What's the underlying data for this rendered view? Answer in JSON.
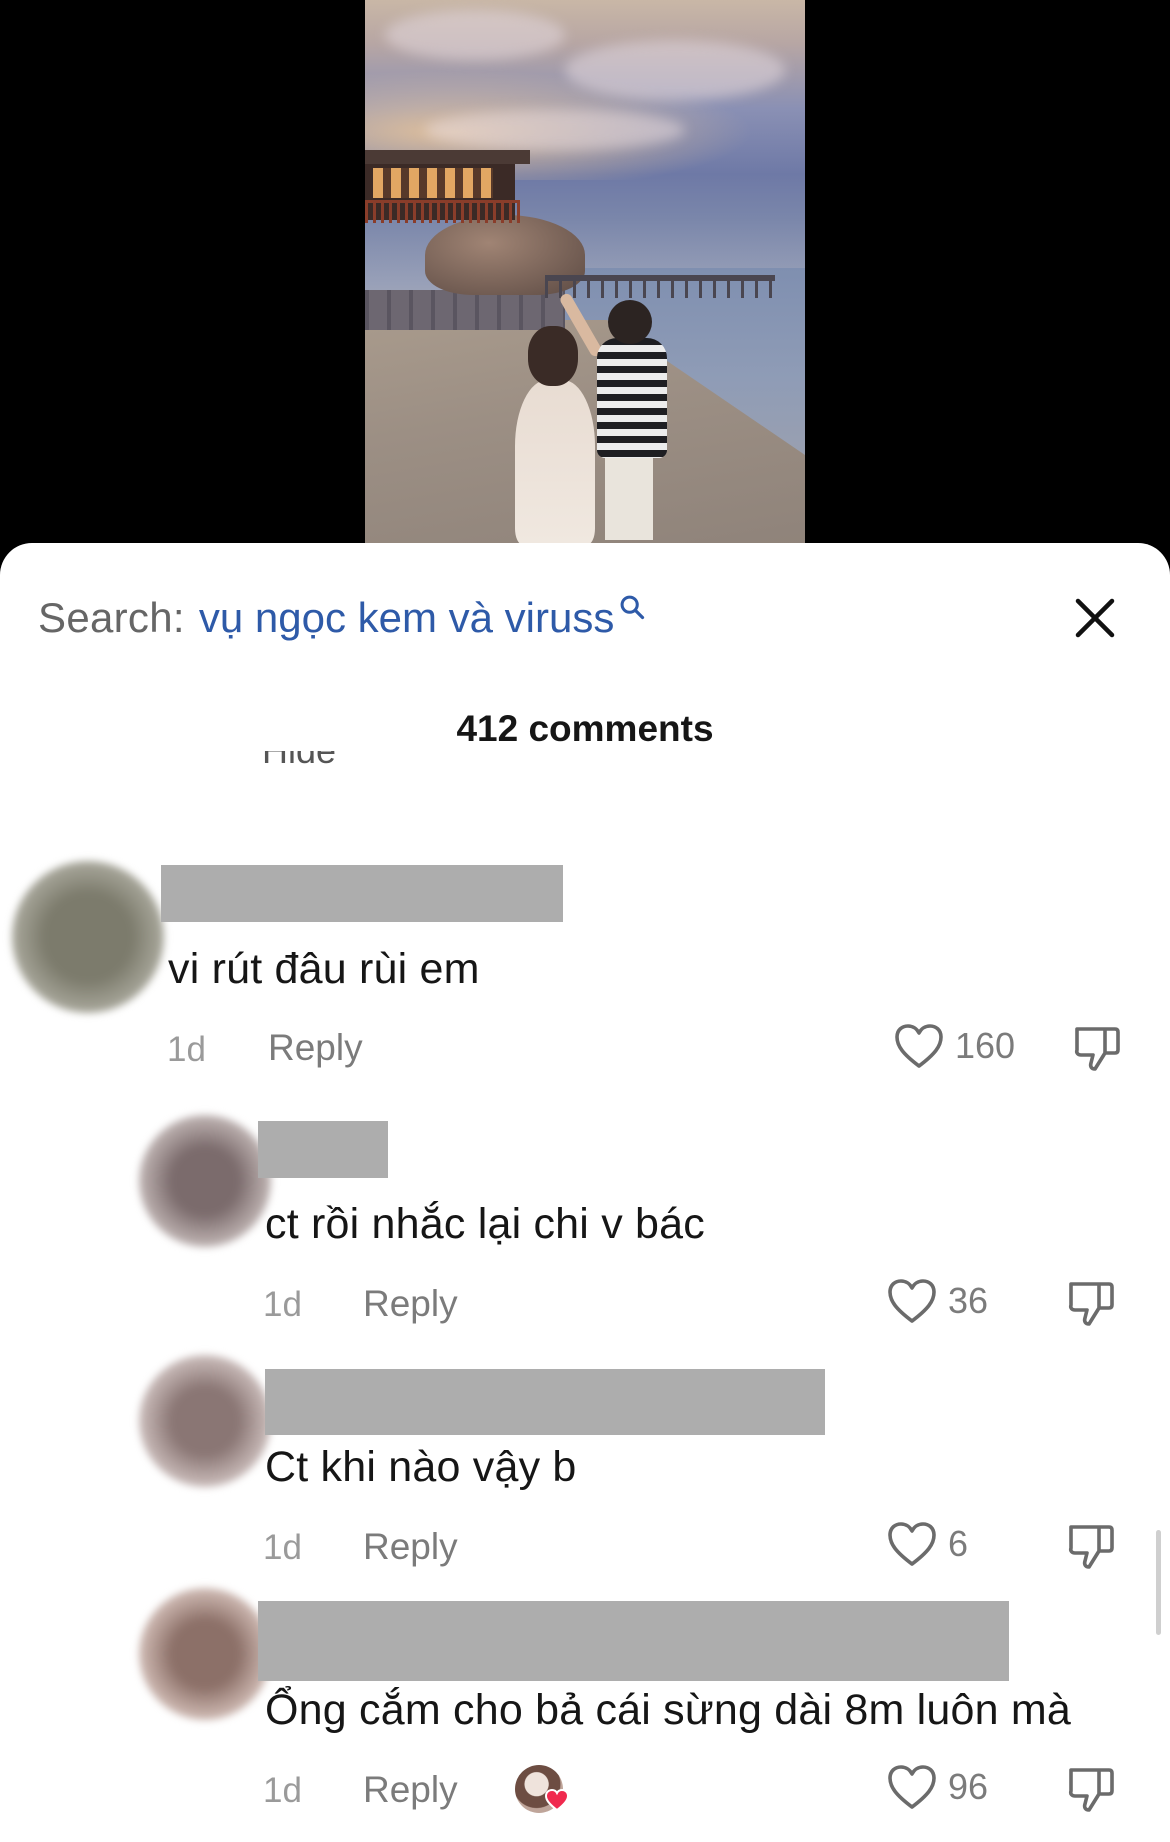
{
  "search": {
    "label": "Search:",
    "query": "vụ ngọc kem và viruss",
    "icon": "search-icon"
  },
  "header": {
    "comments_count": "412 comments",
    "hide_fragment": "Hide ^"
  },
  "colors": {
    "query_blue": "#2e5aa8",
    "muted_gray": "#7b7b7b",
    "redaction_gray": "#adadad"
  },
  "comments": [
    {
      "text": "vi rút đâu rùi em",
      "time": "1d",
      "reply_label": "Reply",
      "likes": "160"
    },
    {
      "text": "ct rồi nhắc lại chi v bác",
      "time": "1d",
      "reply_label": "Reply",
      "likes": "36"
    },
    {
      "text": "Ct khi nào vậy b",
      "time": "1d",
      "reply_label": "Reply",
      "likes": "6"
    },
    {
      "text": "Ổng cắm cho bả cái sừng dài 8m luôn mà",
      "time": "1d",
      "reply_label": "Reply",
      "likes": "96"
    }
  ]
}
